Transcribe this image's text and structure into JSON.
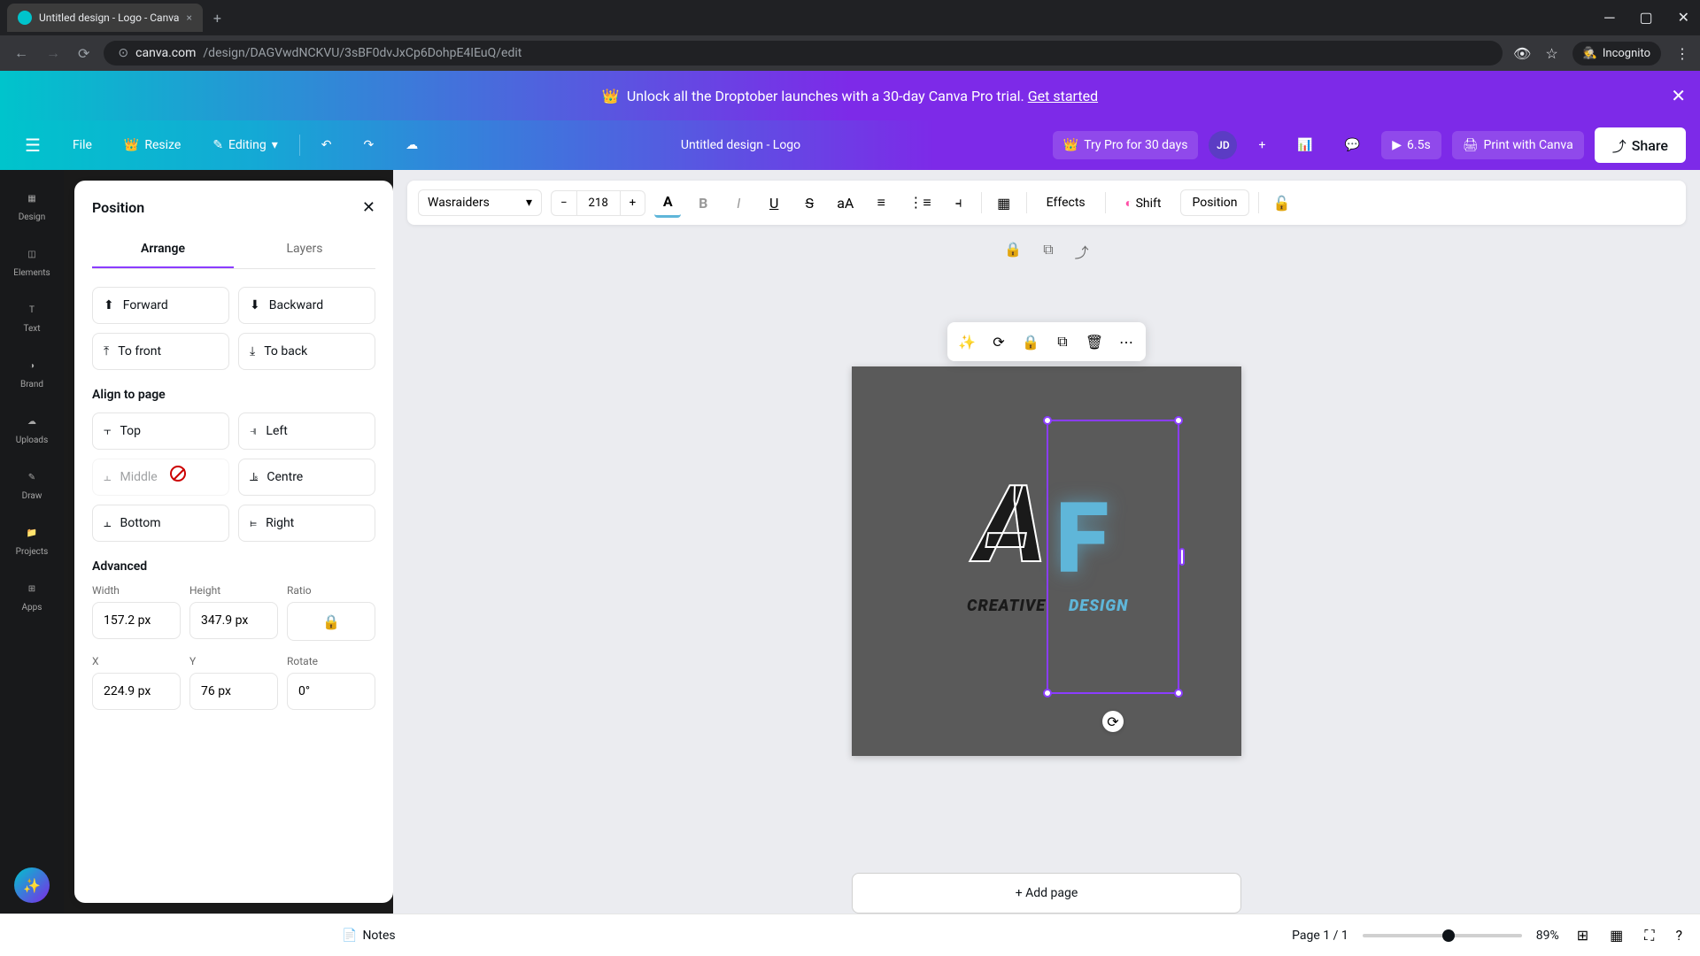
{
  "browser": {
    "tab_title": "Untitled design - Logo - Canva",
    "url_host": "canva.com",
    "url_path": "/design/DAGVwdNCKVU/3sBF0dvJxCp6DohpE4IEuQ/edit",
    "incognito_label": "Incognito"
  },
  "banner": {
    "text": "Unlock all the Droptober launches with a 30-day Canva Pro trial. ",
    "cta": "Get started"
  },
  "toolbar": {
    "file": "File",
    "resize": "Resize",
    "editing": "Editing",
    "doc_title": "Untitled design - Logo",
    "try_pro": "Try Pro for 30 days",
    "avatar_initials": "JD",
    "duration": "6.5s",
    "print": "Print with Canva",
    "share": "Share"
  },
  "nav_rail": {
    "items": [
      "Design",
      "Elements",
      "Text",
      "Brand",
      "Uploads",
      "Draw",
      "Projects",
      "Apps"
    ]
  },
  "position_panel": {
    "title": "Position",
    "tabs": {
      "arrange": "Arrange",
      "layers": "Layers"
    },
    "order": {
      "forward": "Forward",
      "backward": "Backward",
      "to_front": "To front",
      "to_back": "To back"
    },
    "align_section": "Align to page",
    "align": {
      "top": "Top",
      "left": "Left",
      "middle": "Middle",
      "centre": "Centre",
      "bottom": "Bottom",
      "right": "Right"
    },
    "advanced_section": "Advanced",
    "width_label": "Width",
    "width_value": "157.2 px",
    "height_label": "Height",
    "height_value": "347.9 px",
    "ratio_label": "Ratio",
    "x_label": "X",
    "x_value": "224.9 px",
    "y_label": "Y",
    "y_value": "76 px",
    "rotate_label": "Rotate",
    "rotate_value": "0°"
  },
  "text_toolbar": {
    "font": "Wasraiders",
    "size": "218",
    "effects": "Effects",
    "shift": "Shift",
    "position": "Position"
  },
  "canvas": {
    "logo_text1": "CREATIVE",
    "logo_text2": "DESIGN",
    "add_page": "+ Add page"
  },
  "bottom": {
    "notes": "Notes",
    "page_indicator": "Page 1 / 1",
    "zoom": "89%"
  }
}
